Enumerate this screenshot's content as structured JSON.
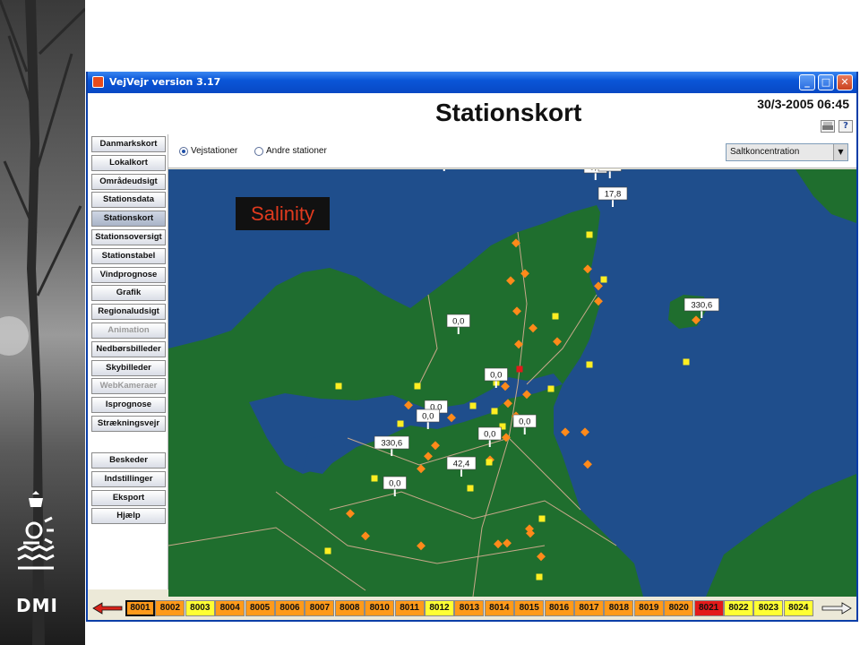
{
  "window": {
    "title": "VejVejr version 3.17",
    "controls": {
      "minimize": "_",
      "maximize": "□",
      "close": "✕"
    }
  },
  "header": {
    "title": "Stationskort",
    "datetime": "30/3-2005 06:45",
    "tools": {
      "print_icon": "printer-icon",
      "help_label": "?"
    }
  },
  "nav": {
    "items": [
      {
        "label": "Danmarkskort",
        "state": "normal"
      },
      {
        "label": "Lokalkort",
        "state": "normal"
      },
      {
        "label": "Områdeudsigt",
        "state": "normal"
      },
      {
        "label": "Stationsdata",
        "state": "normal"
      },
      {
        "label": "Stationskort",
        "state": "active"
      },
      {
        "label": "Stationsoversigt",
        "state": "normal"
      },
      {
        "label": "Stationstabel",
        "state": "normal"
      },
      {
        "label": "Vindprognose",
        "state": "normal"
      },
      {
        "label": "Grafik",
        "state": "normal"
      },
      {
        "label": "Regionaludsigt",
        "state": "normal"
      },
      {
        "label": "Animation",
        "state": "disabled"
      },
      {
        "label": "Nedbørsbilleder",
        "state": "normal"
      },
      {
        "label": "Skybilleder",
        "state": "normal"
      },
      {
        "label": "WebKameraer",
        "state": "disabled"
      },
      {
        "label": "Isprognose",
        "state": "normal"
      },
      {
        "label": "Strækningsvejr",
        "state": "normal"
      }
    ],
    "bottom_items": [
      {
        "label": "Beskeder"
      },
      {
        "label": "Indstillinger"
      },
      {
        "label": "Eksport"
      },
      {
        "label": "Hjælp"
      }
    ]
  },
  "options": {
    "radio_road": "Vejstationer",
    "radio_other": "Andre stationer",
    "selected_radio": "Vejstationer",
    "parameter_select": "Saltkoncentration"
  },
  "map": {
    "overlay_label": "Salinity",
    "station_values": [
      "0,0",
      "0,0",
      "0,0",
      "17,8",
      "330,6",
      "0,0",
      "0,0",
      "0,0",
      "0,0",
      "0,0",
      "330,6",
      "0,0",
      "0,0",
      "42,4"
    ]
  },
  "timeline": {
    "selected": "8001",
    "cells": [
      "8001",
      "8002",
      "8003",
      "8004",
      "8005",
      "8006",
      "8007",
      "8008",
      "8010",
      "8011",
      "8012",
      "8013",
      "8014",
      "8015",
      "8016",
      "8017",
      "8018",
      "8019",
      "8020",
      "8021",
      "8022",
      "8023",
      "8024"
    ],
    "colors": [
      "#ff9a1a",
      "#ff9a1a",
      "#ffff33",
      "#ff9a1a",
      "#ff9a1a",
      "#ff9a1a",
      "#ff9a1a",
      "#ff9a1a",
      "#ff9a1a",
      "#ff9a1a",
      "#ffff33",
      "#ff9a1a",
      "#ff9a1a",
      "#ff9a1a",
      "#ff9a1a",
      "#ff9a1a",
      "#ff9a1a",
      "#ff9a1a",
      "#ff9a1a",
      "#e31a1a",
      "#ffff33",
      "#ffff33",
      "#ffff33"
    ]
  },
  "colors": {
    "sea": "#1f4e8c",
    "land": "#1f6e2e",
    "roads": "#c8a88a",
    "station_orange": "#ff8a1a",
    "station_yellow": "#ffee22",
    "station_red": "#e31a1a",
    "title_bar": "#0a56d8"
  }
}
